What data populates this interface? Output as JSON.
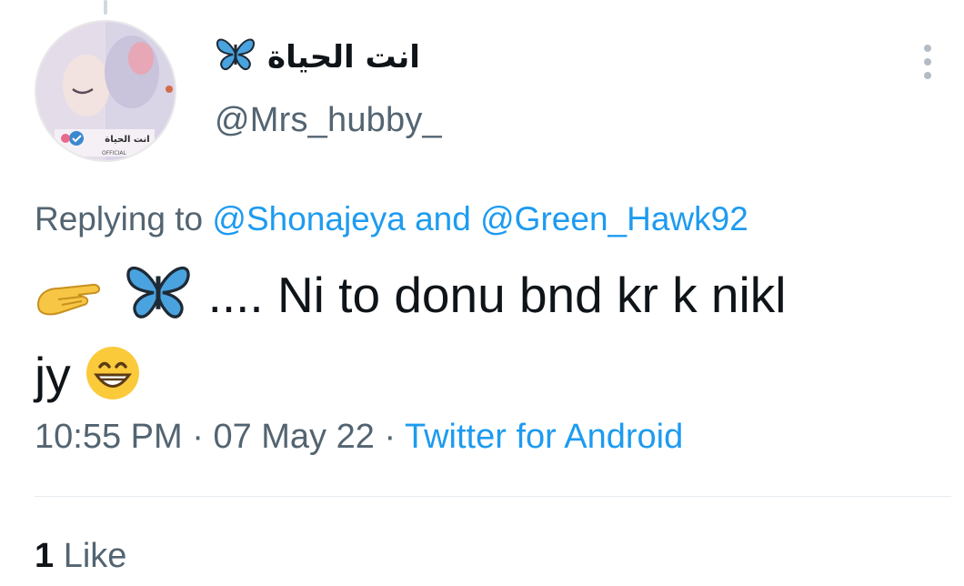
{
  "author": {
    "display_name": "انت الحياة",
    "handle": "@Mrs_hubby_",
    "avatar_text": "انت الحياة",
    "avatar_badge": "OFFICIAL"
  },
  "reply": {
    "prefix": "Replying to",
    "mention_1": "@Shonajeya",
    "joiner": "and",
    "mention_2": "@Green_Hawk92"
  },
  "tweet": {
    "text_line1": ".... Ni to donu bnd kr k nikl",
    "text_line2": "jy",
    "emojis": [
      "pointing-hand-icon",
      "butterfly-icon",
      "grinning-face-icon"
    ]
  },
  "meta": {
    "time": "10:55 PM",
    "separator": "·",
    "date": "07 May 22",
    "source": "Twitter for Android"
  },
  "engagement": {
    "likes_count": "1",
    "likes_label": "Like"
  },
  "colors": {
    "link": "#1d9bf0",
    "secondary_text": "#536471",
    "butterfly": "#4aa3df"
  }
}
